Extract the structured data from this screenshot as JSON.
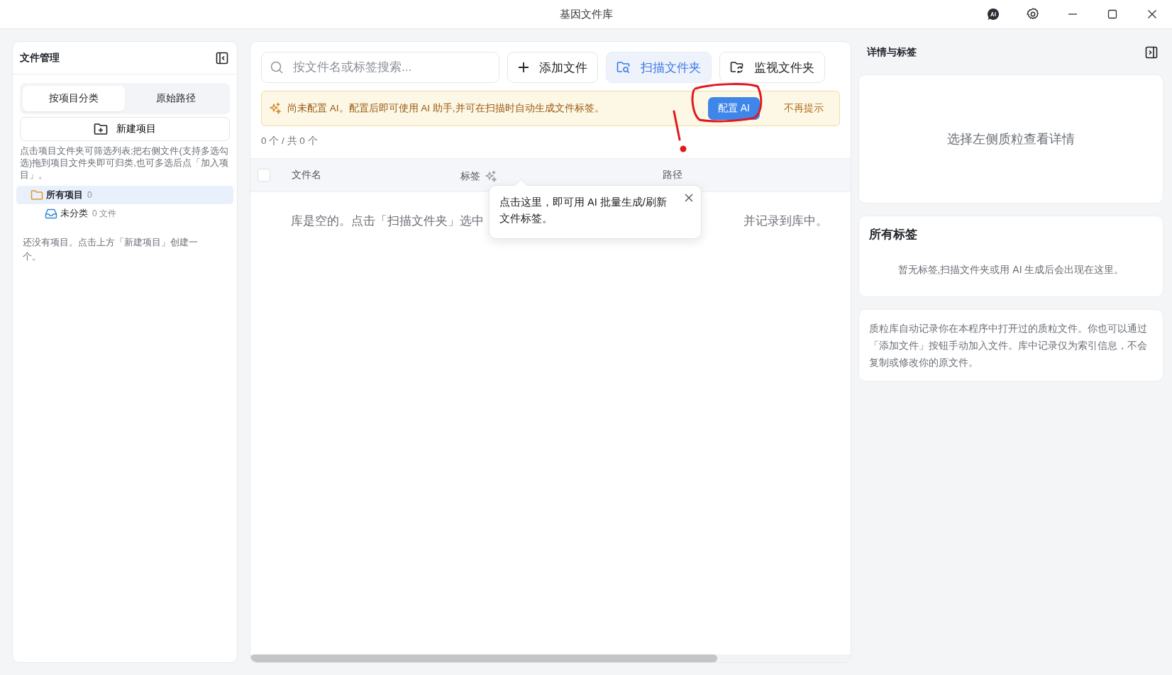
{
  "window": {
    "title": "基因文件库"
  },
  "sidebar": {
    "title": "文件管理",
    "tabs": [
      {
        "label": "按项目分类",
        "selected": true
      },
      {
        "label": "原始路径",
        "selected": false
      }
    ],
    "new_button": "新建项目",
    "hint": "点击项目文件夹可筛选列表;把右侧文件(支持多选勾选)拖到项目文件夹即可归类,也可多选后点「加入项目」。",
    "tree": [
      {
        "label": "所有项目",
        "count": "0",
        "kind": "folder",
        "selected": true,
        "children": [
          {
            "label": "未分类",
            "count": "0 文件",
            "kind": "inbox",
            "selected": false
          }
        ]
      }
    ],
    "empty_text": "还没有项目。点击上方「新建项目」创建一个。"
  },
  "toolbar": {
    "search": {
      "placeholder": "按文件名或标签搜索..."
    },
    "buttons": [
      {
        "label": "添加文件",
        "kind": "add",
        "selected": false
      },
      {
        "label": "扫描文件夹",
        "kind": "scan",
        "selected": true
      },
      {
        "label": "监视文件夹",
        "kind": "watch",
        "selected": false
      }
    ]
  },
  "banner": {
    "message": "尚未配置 AI。配置后即可使用 AI 助手,并可在扫描时自动生成文件标签。",
    "action": "配置 AI",
    "dismiss": "不再提示"
  },
  "count": "0 个 / 共 0 个",
  "table": {
    "checked": false,
    "columns": [
      {
        "label": "文件名",
        "ai_button": false
      },
      {
        "label": "标签",
        "ai_button": true
      },
      {
        "label": "路径",
        "ai_button": false
      }
    ],
    "empty_parts": [
      "库是空的。点击「扫描文件夹」选中",
      "并记录到库中。"
    ]
  },
  "tooltip": {
    "text": "点击这里，即可用 AI 批量生成/刷新文件标签。"
  },
  "details": {
    "title": "详情与标签",
    "placeholder": "选择左侧质粒查看详情",
    "tags_title": "所有标签",
    "tags_empty": "暂无标签,扫描文件夹或用 AI 生成后会出现在这里。",
    "note": "质粒库自动记录你在本程序中打开过的质粒文件。你也可以通过「添加文件」按钮手动加入文件。库中记录仅为索引信息，不会复制或修改你的原文件。"
  }
}
